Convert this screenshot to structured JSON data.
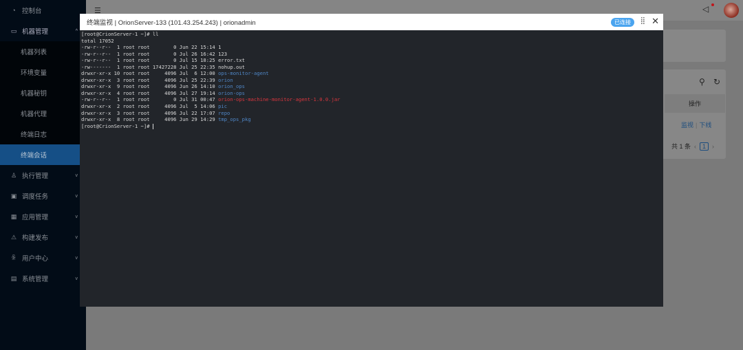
{
  "sidebar": {
    "items": [
      {
        "label": "控制台",
        "icon": "dashboard-icon"
      },
      {
        "label": "机器管理",
        "icon": "monitor-icon",
        "expanded": true,
        "children": [
          {
            "label": "机器列表"
          },
          {
            "label": "环境变量"
          },
          {
            "label": "机器秘钥"
          },
          {
            "label": "机器代理"
          },
          {
            "label": "终端日志"
          },
          {
            "label": "终端会话",
            "active": true
          }
        ]
      },
      {
        "label": "执行管理",
        "icon": "cluster-icon"
      },
      {
        "label": "调度任务",
        "icon": "schedule-icon"
      },
      {
        "label": "应用管理",
        "icon": "appstore-icon"
      },
      {
        "label": "构建发布",
        "icon": "build-icon"
      },
      {
        "label": "用户中心",
        "icon": "user-icon"
      },
      {
        "label": "系统管理",
        "icon": "setting-icon"
      }
    ]
  },
  "page": {
    "column_header": "操作",
    "action_monitor": "监视",
    "action_offline": "下线",
    "total": "共 1 条",
    "current_page": "1"
  },
  "modal": {
    "title": "终端监视 | OrionServer-133 (101.43.254.243) | orionadmin",
    "status": "已连接",
    "status_color": "#4aa4ef"
  },
  "terminal": {
    "prompt": "[root@CrionServer-1 ~]# ",
    "command": "ll",
    "total": "total 17052",
    "entries": [
      {
        "meta": "-rw-r--r--  1 root root        0 Jun 22 15:14 ",
        "name": "1",
        "color": "default"
      },
      {
        "meta": "-rw-r--r--  1 root root        0 Jul 26 16:42 ",
        "name": "123",
        "color": "default"
      },
      {
        "meta": "-rw-r--r--  1 root root        0 Jul 15 18:25 ",
        "name": "error.txt",
        "color": "default"
      },
      {
        "meta": "-rw-------  1 root root 17427228 Jul 25 22:35 ",
        "name": "nohup.out",
        "color": "default"
      },
      {
        "meta": "drwxr-xr-x 10 root root     4096 Jul  6 12:00 ",
        "name": "ops-monitor-agent",
        "color": "blue"
      },
      {
        "meta": "drwxr-xr-x  3 root root     4096 Jul 25 22:39 ",
        "name": "orion",
        "color": "blue"
      },
      {
        "meta": "drwxr-xr-x  9 root root     4096 Jun 26 14:10 ",
        "name": "orion_ops",
        "color": "blue"
      },
      {
        "meta": "drwxr-xr-x  4 root root     4096 Jul 27 19:14 ",
        "name": "orion-ops",
        "color": "blue"
      },
      {
        "meta": "-rw-r--r--  1 root root        0 Jul 31 00:47 ",
        "name": "orion-ops-machine-monitor-agent-1.0.0.jar",
        "color": "red"
      },
      {
        "meta": "drwxr-xr-x  2 root root     4096 Jul  5 14:06 ",
        "name": "pic",
        "color": "blue"
      },
      {
        "meta": "drwxr-xr-x  3 root root     4096 Jul 22 17:07 ",
        "name": "repo",
        "color": "blue"
      },
      {
        "meta": "drwxr-xr-x  8 root root     4096 Jun 29 14:29 ",
        "name": "tmp_ops_pkg",
        "color": "blue"
      }
    ]
  }
}
